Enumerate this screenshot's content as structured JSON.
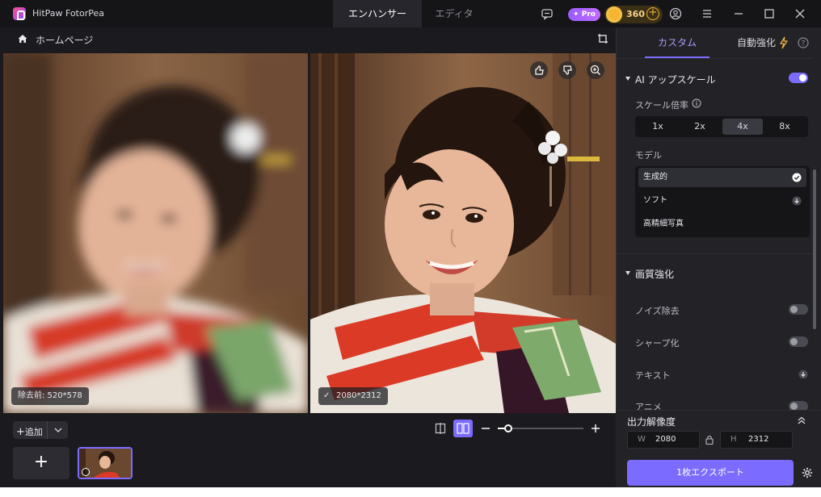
{
  "app": {
    "title": "HitPaw FotorPea",
    "tabs": [
      "エンハンサー",
      "エディタ"
    ],
    "active_tab": "エンハンサー",
    "pro_badge": "Pro",
    "credits": "360",
    "accent_color": "#7b6cff"
  },
  "toolbar": {
    "home_label": "ホームページ"
  },
  "preview": {
    "before_label": "除去前: 520*578",
    "after_label": "2080*2312"
  },
  "bottom": {
    "add_label": "追加",
    "add_button_icon": "plus-icon",
    "zoom_level": 0.12
  },
  "right_panel": {
    "tab_custom": "カスタム",
    "tab_auto": "自動強化",
    "ai_upscale": {
      "title": "AI アップスケール",
      "enabled": true,
      "scale_label": "スケール倍率",
      "scale_options": [
        "1x",
        "2x",
        "4x",
        "8x"
      ],
      "selected_scale": "4x",
      "model_label": "モデル",
      "models": [
        "生成的",
        "ソフト",
        "高精細写真"
      ],
      "selected_model": "生成的"
    },
    "quality": {
      "title": "画質強化",
      "options": [
        {
          "label": "ノイズ除去",
          "control": "toggle",
          "on": false
        },
        {
          "label": "シャープ化",
          "control": "toggle",
          "on": false
        },
        {
          "label": "テキスト",
          "control": "download"
        },
        {
          "label": "アニメ",
          "control": "toggle",
          "on": false
        }
      ]
    },
    "output": {
      "title": "出力解像度",
      "width_label": "W",
      "width": "2080",
      "height_label": "H",
      "height": "2312",
      "export_label": "1枚エクスポート"
    }
  }
}
